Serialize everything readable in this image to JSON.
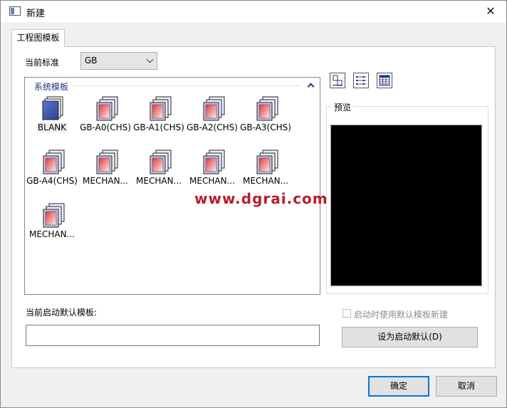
{
  "window": {
    "title": "新建",
    "close_glyph": "✕"
  },
  "tab": {
    "label": "工程图模板"
  },
  "standard": {
    "label": "当前标准",
    "value": "GB"
  },
  "template_group": {
    "title": "系统模板",
    "items": [
      {
        "label": "BLANK",
        "selected": true
      },
      {
        "label": "GB-A0(CHS)"
      },
      {
        "label": "GB-A1(CHS)"
      },
      {
        "label": "GB-A2(CHS)"
      },
      {
        "label": "GB-A3(CHS)"
      },
      {
        "label": "GB-A4(CHS)"
      },
      {
        "label": "MECHAN..."
      },
      {
        "label": "MECHAN..."
      },
      {
        "label": "MECHAN..."
      },
      {
        "label": "MECHAN..."
      },
      {
        "label": "MECHAN..."
      }
    ]
  },
  "view_modes": [
    "large-icon-view-icon",
    "list-view-icon",
    "detail-view-icon"
  ],
  "preview": {
    "title": "预览",
    "background": "#000000"
  },
  "watermark": "www.dgrai.com",
  "default_template": {
    "label": "当前启动默认模板:",
    "value": ""
  },
  "startup_checkbox": {
    "label": "启动时使用默认模板新建",
    "checked": false,
    "disabled": true
  },
  "buttons": {
    "set_default": "设为启动默认(D)",
    "ok": "确定",
    "cancel": "取消"
  },
  "colors": {
    "accent": "#0078d7",
    "group_title": "#1e3287",
    "watermark": "#b51f2e"
  }
}
